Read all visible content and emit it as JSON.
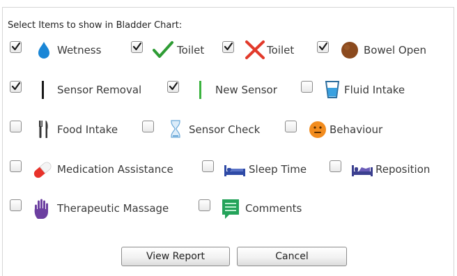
{
  "header": {
    "title": "Select Items to show in Bladder Chart:"
  },
  "colors": {
    "wetness": "#1a86d6",
    "toilet_tick": "#2e9c34",
    "toilet_cross": "#e23a2b",
    "bowel": "#8b4a1e",
    "new_sensor": "#3bb33f",
    "behaviour": "#f28c1e",
    "sleep": "#2e4aa6",
    "massage": "#6c3fa0",
    "comments": "#24a35a"
  },
  "items": [
    {
      "label": "Wetness",
      "checked": true,
      "icon": "water-drop-icon"
    },
    {
      "label": "Toilet",
      "checked": true,
      "icon": "green-check-icon"
    },
    {
      "label": "Toilet",
      "checked": true,
      "icon": "red-cross-icon"
    },
    {
      "label": "Bowel Open",
      "checked": true,
      "icon": "brown-circle-icon"
    },
    {
      "label": "Sensor Removal",
      "checked": true,
      "icon": "black-bar-icon"
    },
    {
      "label": "New Sensor",
      "checked": true,
      "icon": "green-bar-icon"
    },
    {
      "label": "Fluid Intake",
      "checked": false,
      "icon": "glass-icon"
    },
    {
      "label": "Food Intake",
      "checked": false,
      "icon": "cutlery-icon"
    },
    {
      "label": "Sensor Check",
      "checked": false,
      "icon": "hourglass-icon"
    },
    {
      "label": "Behaviour",
      "checked": false,
      "icon": "face-icon"
    },
    {
      "label": "Medication Assistance",
      "checked": false,
      "icon": "pill-icon"
    },
    {
      "label": "Sleep Time",
      "checked": false,
      "icon": "bed-icon"
    },
    {
      "label": "Reposition",
      "checked": false,
      "icon": "bed-reposition-icon"
    },
    {
      "label": "Therapeutic Massage",
      "checked": false,
      "icon": "hand-icon"
    },
    {
      "label": "Comments",
      "checked": false,
      "icon": "comment-icon"
    }
  ],
  "buttons": {
    "view_report": "View Report",
    "cancel": "Cancel"
  }
}
